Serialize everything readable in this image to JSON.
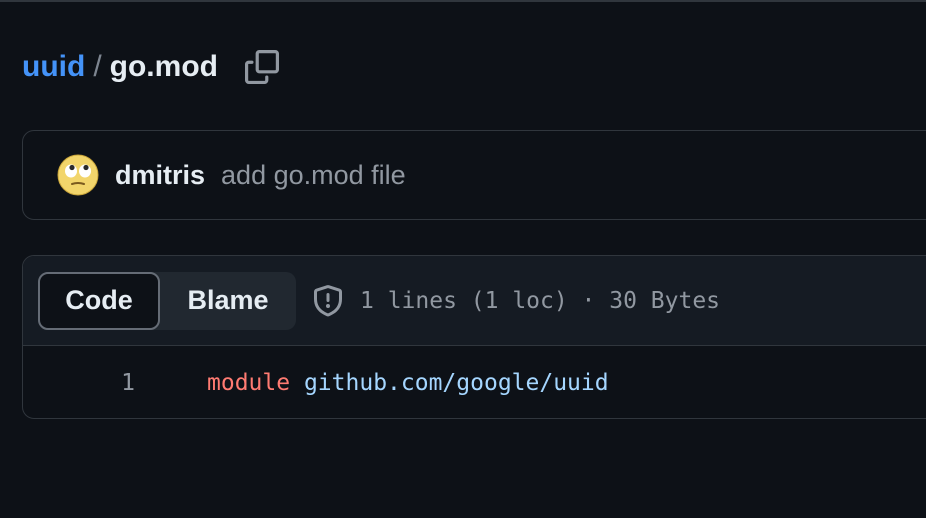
{
  "breadcrumb": {
    "repo": "uuid",
    "separator": "/",
    "file": "go.mod"
  },
  "icons": {
    "copy": "copy-icon",
    "shield": "shield-icon",
    "avatar": "eye-roll-emoji-avatar"
  },
  "commit": {
    "author": "dmitris",
    "message": "add go.mod file"
  },
  "file": {
    "tabs": [
      {
        "label": "Code",
        "active": true
      },
      {
        "label": "Blame",
        "active": false
      }
    ],
    "meta": "1 lines (1 loc) · 30 Bytes",
    "lines": [
      {
        "number": "1",
        "keyword": "module",
        "space": " ",
        "path": "github.com/google/uuid"
      }
    ]
  },
  "colors": {
    "background": "#0d1117",
    "link": "#4493f8",
    "keyword": "#ff7b72",
    "string": "#a5d6ff",
    "border": "#30363d"
  }
}
